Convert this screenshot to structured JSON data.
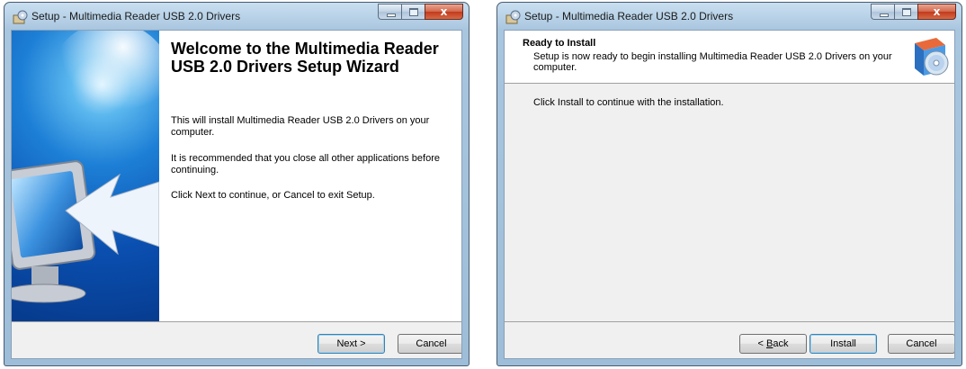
{
  "windows": [
    {
      "title": "Setup - Multimedia Reader USB 2.0 Drivers",
      "welcome_title": "Welcome to the Multimedia Reader USB 2.0 Drivers Setup Wizard",
      "paragraphs": [
        "This will install Multimedia Reader USB 2.0 Drivers on your computer.",
        "It is recommended that you close all other applications before continuing.",
        "Click Next to continue, or Cancel to exit Setup."
      ],
      "buttons": {
        "next": "Next >",
        "cancel": "Cancel"
      }
    },
    {
      "title": "Setup - Multimedia Reader USB 2.0 Drivers",
      "header_title": "Ready to Install",
      "header_subtitle": "Setup is now ready to begin installing Multimedia Reader USB 2.0 Drivers on your computer.",
      "body_text": "Click Install to continue with the installation.",
      "buttons": {
        "back_prefix": "< ",
        "back_key": "B",
        "back_rest": "ack",
        "install": "Install",
        "cancel": "Cancel"
      }
    }
  ],
  "caption_buttons": {
    "close_glyph": "x"
  },
  "icons": [
    "setup-app-icon",
    "monitor-arrow-illustration",
    "software-box-cd-icon"
  ],
  "colors": {
    "side_panel": "#0a4fb0",
    "default_button_border": "#3c7fb1",
    "close_button": "#c2391c"
  }
}
